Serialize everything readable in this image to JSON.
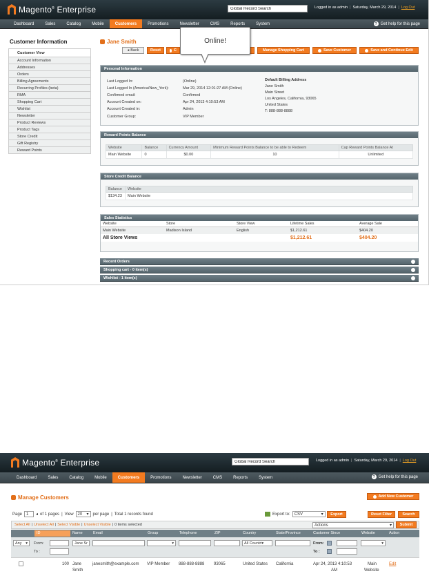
{
  "header": {
    "brand": "Magento",
    "brand_edition": "Enterprise",
    "search_value": "Global Record Search",
    "logged_in": "Logged in as admin",
    "date": "Saturday, March 29, 2014",
    "logout": "Log Out",
    "help": "Get help for this page"
  },
  "nav": [
    "Dashboard",
    "Sales",
    "Catalog",
    "Mobile",
    "Customers",
    "Promotions",
    "Newsletter",
    "CMS",
    "Reports",
    "System"
  ],
  "sidebar": {
    "title": "Customer Information",
    "items": [
      "Customer View",
      "Account Information",
      "Addresses",
      "Orders",
      "Billing Agreements",
      "Recurring Profiles (beta)",
      "RMA",
      "Shopping Cart",
      "Wishlist",
      "Newsletter",
      "Product Reviews",
      "Product Tags",
      "Store Credit",
      "Gift Registry",
      "Reward Points"
    ]
  },
  "customer": {
    "name": "Jane Smith",
    "back": "Back",
    "reset": "Reset",
    "create_order_stub": "C",
    "manage_cart": "Manage Shopping Cart",
    "save": "Save Customer",
    "save_continue": "Save and Continue Edit",
    "callout": "Online!"
  },
  "personal": {
    "title": "Personal Information",
    "rows": [
      {
        "label": "Last Logged In:",
        "value": "(Online)"
      },
      {
        "label": "Last Logged In (America/New_York):",
        "value": "Mar 29, 2014 12:01:27 AM (Online)"
      },
      {
        "label": "Confirmed email:",
        "value": "Confirmed"
      },
      {
        "label": "Account Created on:",
        "value": "Apr 24, 2013 4:10:53 AM"
      },
      {
        "label": "Account Created in:",
        "value": "Admin"
      },
      {
        "label": "Customer Group:",
        "value": "VIP Member"
      }
    ],
    "billing_title": "Default Billing Address",
    "billing_lines": [
      "Jane Smith",
      "Main Street",
      "Los Angeles, California, 93065",
      "United States",
      "T: 888-888-8888"
    ]
  },
  "reward": {
    "title": "Reward Points Balance",
    "headers": [
      "Website",
      "Balance",
      "Currency Amount",
      "Minimum Reward Points Balance to be able to Redeem",
      "Cap Reward Points Balance At"
    ],
    "row": [
      "Main Website",
      "0",
      "$0.00",
      "10",
      "Unlimited"
    ]
  },
  "store_credit": {
    "title": "Store Credit Balance",
    "headers": [
      "Balance",
      "Website"
    ],
    "row": [
      "$134.23",
      "Main Website"
    ]
  },
  "sales_stats": {
    "title": "Sales Statistics",
    "headers": [
      "Website",
      "Store",
      "Store View",
      "Lifetime Sales",
      "Average Sale"
    ],
    "row": [
      "Main Website",
      "Madison Island",
      "English",
      "$1,212.61",
      "$404.20"
    ],
    "total": [
      "All Store Views",
      "$1,212.61",
      "$404.20"
    ]
  },
  "collapsed": [
    "Recent Orders",
    "Shopping cart - 0 item(s)",
    "Wishlist - 1 item(s)"
  ],
  "manage": {
    "title": "Manage Customers",
    "add_new": "Add New Customer",
    "page_label": "Page",
    "page_value": "1",
    "of_pages": "of 1 pages",
    "view": "View",
    "per_page_value": "20",
    "per_page": "per page",
    "total": "Total 1 records found",
    "export_to": "Export to:",
    "export_value": "CSV",
    "export_btn": "Export",
    "reset_filter": "Reset Filter",
    "search": "Search",
    "select_all": "Select All",
    "unselect_all": "Unselect All",
    "select_visible": "Select Visible",
    "unselect_visible": "Unselect Visible",
    "items_selected": "0 items selected",
    "actions": "Actions",
    "submit": "Submit",
    "columns": [
      "ID",
      "Name",
      "Email",
      "Group",
      "Telephone",
      "ZIP",
      "Country",
      "State/Province",
      "Customer Since",
      "Website",
      "Action"
    ],
    "filter_any": "Any",
    "filter_from": "From:",
    "filter_to": "To :",
    "filter_name": "Jane Sr",
    "filter_country": "All Countri",
    "row": {
      "id": "100",
      "name1": "Jane",
      "name2": "Smith",
      "email": "janesmith@example.com",
      "group": "VIP Member",
      "telephone": "888-888-8888",
      "zip": "93065",
      "country": "United States",
      "state": "California",
      "since1": "Apr 24, 2013 4:10:53",
      "since2": "AM",
      "website1": "Main",
      "website2": "Website",
      "action": "Edit"
    }
  },
  "colors": {
    "accent": "#f37b20",
    "header_bg": "#1e2a31",
    "section_head": "#6f7f87"
  }
}
